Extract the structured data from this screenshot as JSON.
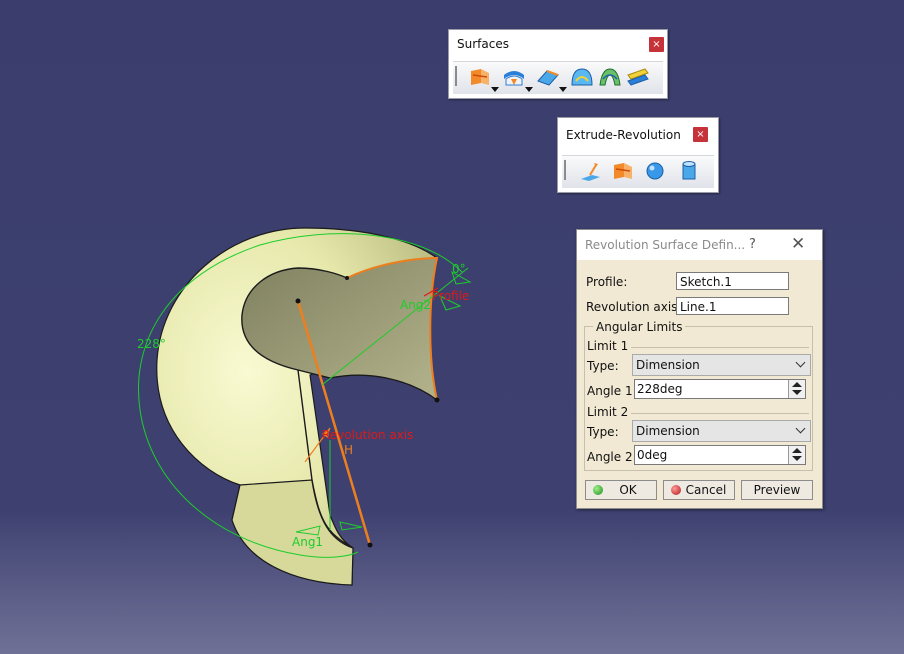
{
  "toolbars": {
    "surfaces": {
      "title": "Surfaces",
      "close": "×",
      "icons": [
        "extrude-surface-icon",
        "offset-surface-icon",
        "sweep-surface-icon",
        "fill-surface-icon",
        "multi-section-surface-icon",
        "blend-surface-icon"
      ]
    },
    "extrude_revolution": {
      "title": "Extrude-Revolution",
      "close": "×",
      "icons": [
        "extrude-icon",
        "revolve-icon",
        "sphere-icon",
        "cylinder-icon"
      ]
    }
  },
  "dialog": {
    "title": "Revolution Surface Defin...",
    "help": "?",
    "close": "✕",
    "profile_label": "Profile:",
    "profile_value": "Sketch.1",
    "axis_label": "Revolution axis:",
    "axis_value": "Line.1",
    "angular_limits_label": "Angular Limits",
    "limit1_label": "Limit 1",
    "limit1_type_label": "Type:",
    "limit1_type_value": "Dimension",
    "angle1_label": "Angle 1:",
    "angle1_value": "228deg",
    "limit2_label": "Limit 2",
    "limit2_type_label": "Type:",
    "limit2_type_value": "Dimension",
    "angle2_label": "Angle 2:",
    "angle2_value": "0deg",
    "ok_label": "OK",
    "cancel_label": "Cancel",
    "preview_label": "Preview"
  },
  "viewport": {
    "angle1_dim": "228°",
    "angle2_dim": "0°",
    "ang1_label": "Ang1",
    "ang2_label": "Ang2",
    "profile_label": "Profile",
    "axis_label": "Revolution axis",
    "h_label": "H",
    "colors": {
      "surface": "#e4e6a8",
      "inner_surface": "#9c9c78",
      "axis": "#ee7f1f",
      "dimension": "#1dcc2c",
      "annotation": "#dd1a1a"
    }
  }
}
